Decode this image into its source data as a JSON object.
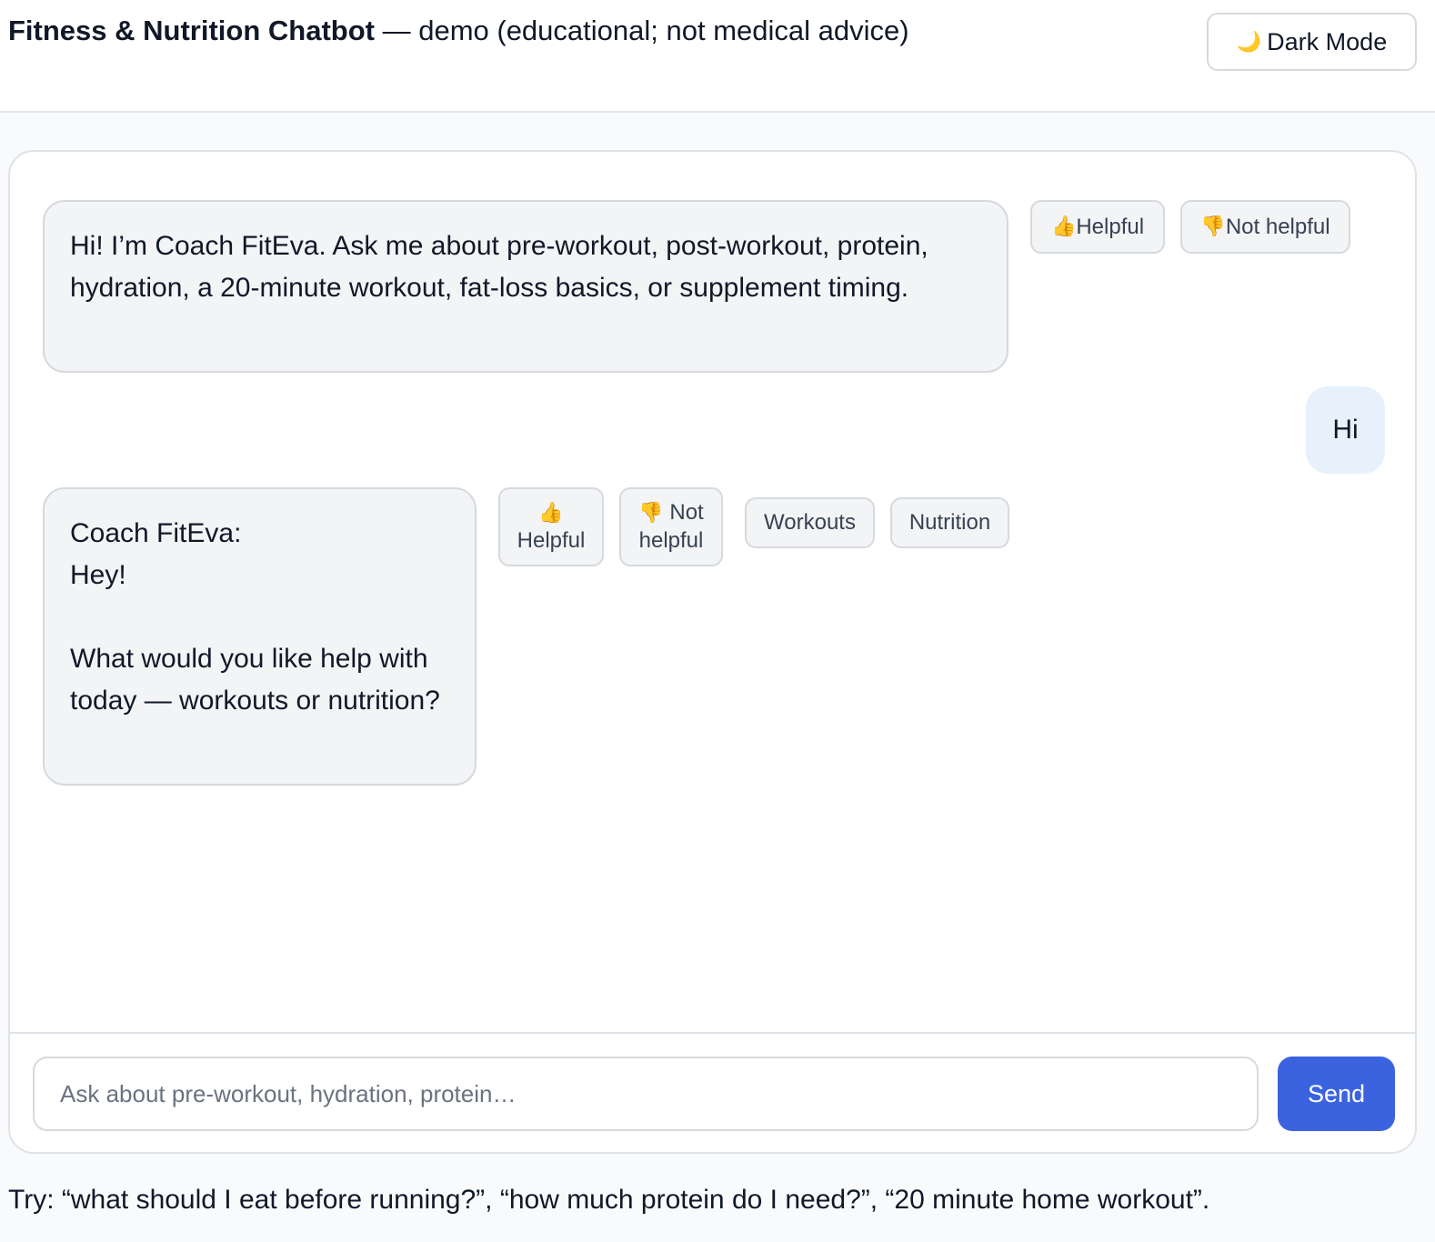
{
  "header": {
    "title_bold": "Fitness & Nutrition Chatbot",
    "title_rest": " — demo (educational; not medical advice)",
    "dark_mode_icon": "🌙",
    "dark_mode_label": "Dark Mode"
  },
  "messages": [
    {
      "role": "bot",
      "text": "Hi! I’m Coach FitEva. Ask me about pre-workout, post-workout, protein, hydration, a 20-minute workout, fat-loss basics, or supplement timing.",
      "feedback": {
        "helpful_icon": "👍",
        "helpful": "Helpful",
        "not_helpful_icon": "👎",
        "not_helpful": "Not helpful"
      }
    },
    {
      "role": "user",
      "text": "Hi"
    },
    {
      "role": "bot",
      "lines": [
        "Coach FitEva:",
        "Hey!",
        "",
        "What would you like help with today — workouts or nutrition?"
      ],
      "feedback": {
        "helpful_icon": "👍",
        "helpful": "Helpful",
        "not_helpful_icon": "👎",
        "not_helpful_line1": "Not",
        "not_helpful_line2": "helpful"
      },
      "quick_replies": [
        "Workouts",
        "Nutrition"
      ]
    }
  ],
  "composer": {
    "placeholder": "Ask about pre-workout, hydration, protein…",
    "value": "",
    "send_label": "Send"
  },
  "hint": "Try: “what should I eat before running?”, “how much protein do I need?”, “20 minute home workout”.",
  "colors": {
    "accent": "#3b63e0",
    "user_bubble": "#e6f1fc",
    "bot_bubble": "#f3f4f6"
  }
}
